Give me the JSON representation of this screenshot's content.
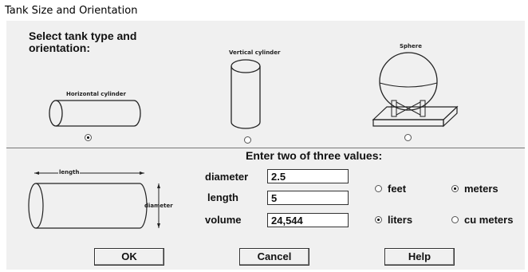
{
  "window": {
    "title": "Tank Size and Orientation"
  },
  "orientation": {
    "heading": "Select tank type and orientation:",
    "options": {
      "horizontal": {
        "label": "Horizontal cylinder",
        "selected": true
      },
      "vertical": {
        "label": "Vertical cylinder",
        "selected": false
      },
      "sphere": {
        "label": "Sphere",
        "selected": false
      }
    }
  },
  "values": {
    "heading": "Enter two of three values:",
    "diagram": {
      "length_label": "length",
      "diameter_label": "diameter"
    },
    "fields": {
      "diameter": {
        "label": "diameter",
        "value": "2.5"
      },
      "length": {
        "label": "length",
        "value": "5"
      },
      "volume": {
        "label": "volume",
        "value": "24,544"
      }
    },
    "length_units": {
      "feet": {
        "label": "feet",
        "selected": false
      },
      "meters": {
        "label": "meters",
        "selected": true
      }
    },
    "volume_units": {
      "liters": {
        "label": "liters",
        "selected": true
      },
      "cu_meters": {
        "label": "cu meters",
        "selected": false
      }
    }
  },
  "buttons": {
    "ok": "OK",
    "cancel": "Cancel",
    "help": "Help"
  }
}
